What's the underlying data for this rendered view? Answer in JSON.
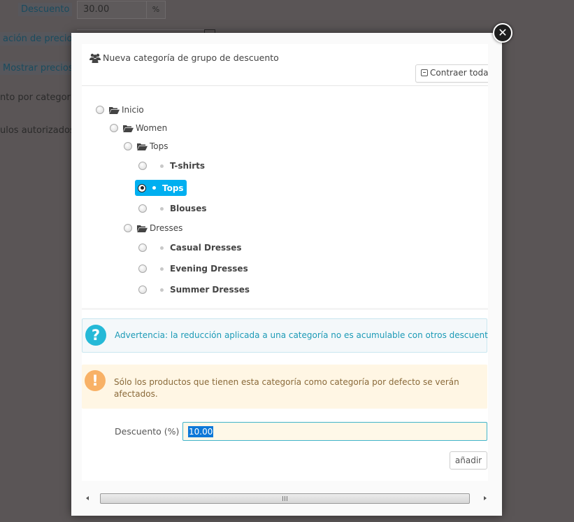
{
  "background_page": {
    "rows": [
      {
        "label": "Descuento",
        "value": "30.00",
        "addon": "%"
      },
      {
        "label": "ación de precios"
      },
      {
        "label": "Mostrar precios"
      },
      {
        "label": "nto por categoría"
      },
      {
        "label": "ulos autorizados"
      }
    ]
  },
  "modal": {
    "close_icon": "close-icon",
    "title": "Nueva categoría de grupo de descuento",
    "title_icon": "users-icon",
    "collapse_all_label": "Contraer todas",
    "tree": [
      {
        "label": "Inicio",
        "type": "folder",
        "level": 0,
        "selected": false
      },
      {
        "label": "Women",
        "type": "folder",
        "level": 1,
        "selected": false
      },
      {
        "label": "Tops",
        "type": "folder",
        "level": 2,
        "selected": false
      },
      {
        "label": "T-shirts",
        "type": "leaf",
        "level": 3,
        "selected": false
      },
      {
        "label": "Tops",
        "type": "leaf",
        "level": 3,
        "selected": true
      },
      {
        "label": "Blouses",
        "type": "leaf",
        "level": 3,
        "selected": false
      },
      {
        "label": "Dresses",
        "type": "folder",
        "level": 2,
        "selected": false
      },
      {
        "label": "Casual Dresses",
        "type": "leaf",
        "level": 3,
        "selected": false
      },
      {
        "label": "Evening Dresses",
        "type": "leaf",
        "level": 3,
        "selected": false
      },
      {
        "label": "Summer Dresses",
        "type": "leaf",
        "level": 3,
        "selected": false
      }
    ],
    "info_alert": {
      "icon": "question-icon",
      "text": "Advertencia: la reducción aplicada a una categoría no es acumulable con otros descuentos."
    },
    "warning_alert": {
      "icon": "exclamation-icon",
      "text": "Sólo los productos que tienen esta categoría como categoría por defecto se verán afectados."
    },
    "discount_label": "Descuento (%)",
    "discount_value": "10.00",
    "add_button_label": "añadir",
    "colors": {
      "selected_node": "#00aff0",
      "info": "#25b9d7",
      "warning": "#f8b166"
    }
  }
}
